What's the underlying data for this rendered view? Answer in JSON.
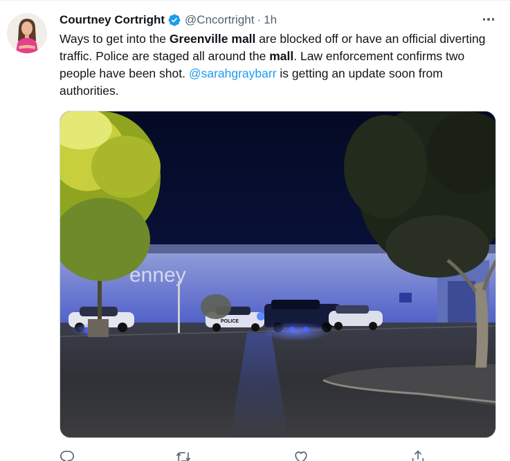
{
  "tweet": {
    "author_name": "Courtney Cortright",
    "handle": "@Cncortright",
    "separator": "·",
    "timestamp": "1h",
    "text_parts": [
      "Ways to get into the ",
      "Greenville mall",
      " are blocked off or have an official diverting traffic. Police are staged all around the ",
      "mall",
      ". Law enforcement confirms two people have been shot. ",
      "@sarahgraybarr",
      " is getting an update soon from authorities."
    ],
    "media": {
      "store_sign": "enney",
      "car_label": "POLICE"
    }
  },
  "icons": {
    "verified": "verified-badge-icon",
    "more": "more-horizontal-icon",
    "reply": "reply-icon",
    "retweet": "retweet-icon",
    "like": "like-icon",
    "share": "share-icon"
  },
  "colors": {
    "accent": "#1d9bf0",
    "secondary_text": "#536471",
    "primary_text": "#0f1419"
  }
}
